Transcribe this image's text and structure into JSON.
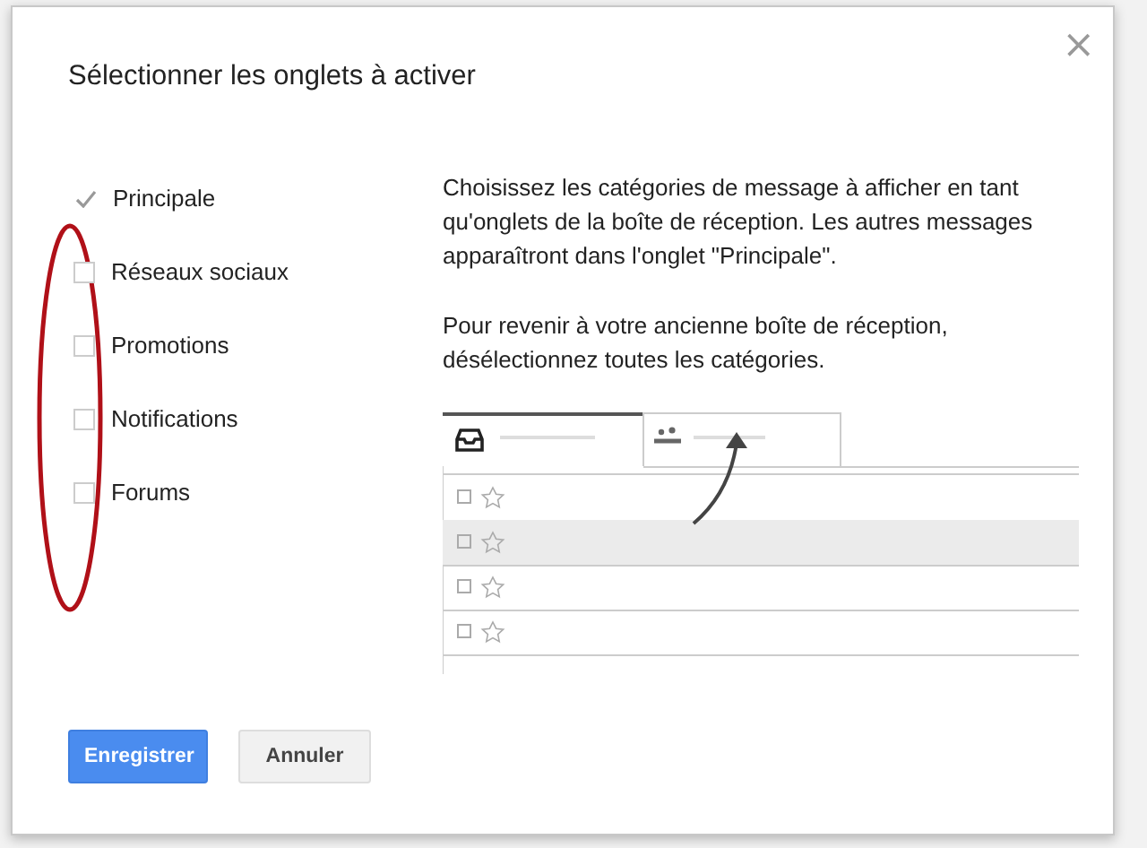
{
  "dialog": {
    "title": "Sélectionner les onglets à activer",
    "close": "×",
    "categories": [
      {
        "label": "Principale",
        "checked": true
      },
      {
        "label": "Réseaux sociaux",
        "checked": false
      },
      {
        "label": "Promotions",
        "checked": false
      },
      {
        "label": "Notifications",
        "checked": false
      },
      {
        "label": "Forums",
        "checked": false
      }
    ],
    "paragraphs": [
      "Choisissez les catégories de message à afficher en tant qu'onglets de la boîte de réception. Les autres messages apparaîtront dans l'onglet \"Principale\".",
      "Pour revenir à votre ancienne boîte de réception, désélectionnez toutes les catégories."
    ],
    "buttons": [
      {
        "label": "Enregistrer",
        "kind": "primary"
      },
      {
        "label": "Annuler",
        "kind": "secondary"
      }
    ]
  }
}
